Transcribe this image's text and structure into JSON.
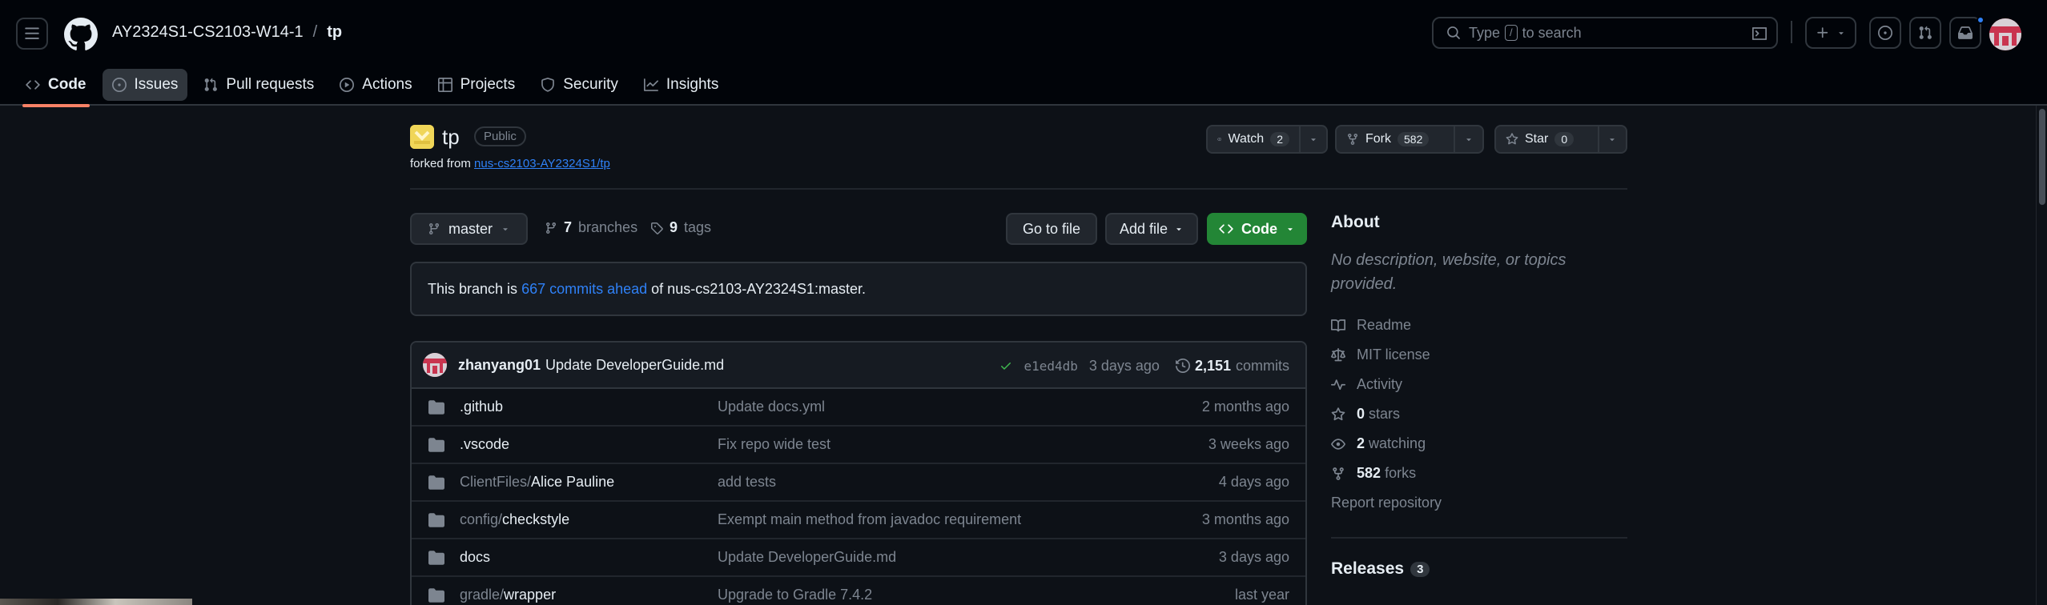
{
  "header": {
    "owner": "AY2324S1-CS2103-W14-1",
    "separator": "/",
    "repo": "tp",
    "search_placeholder_pre": "Type",
    "search_key": "/",
    "search_placeholder_post": "to search"
  },
  "tabs": [
    {
      "label": "Code"
    },
    {
      "label": "Issues"
    },
    {
      "label": "Pull requests"
    },
    {
      "label": "Actions"
    },
    {
      "label": "Projects"
    },
    {
      "label": "Security"
    },
    {
      "label": "Insights"
    }
  ],
  "repo": {
    "name": "tp",
    "visibility": "Public",
    "forked_from_label": "forked from",
    "forked_from": "nus-cs2103-AY2324S1/tp",
    "watch_label": "Watch",
    "watch_count": "2",
    "fork_label": "Fork",
    "fork_count": "582",
    "star_label": "Star",
    "star_count": "0"
  },
  "branch_bar": {
    "branch": "master",
    "branches_count": "7",
    "branches_label": "branches",
    "tags_count": "9",
    "tags_label": "tags",
    "go_to_file": "Go to file",
    "add_file": "Add file",
    "code": "Code"
  },
  "ahead": {
    "prefix": "This branch is",
    "link": "667 commits ahead",
    "suffix": "of nus-cs2103-AY2324S1:master."
  },
  "latest_commit": {
    "author": "zhanyang01",
    "message": "Update DeveloperGuide.md",
    "sha": "e1ed4db",
    "time": "3 days ago",
    "commits_count": "2,151",
    "commits_label": "commits"
  },
  "files": [
    {
      "dir": "",
      "name": ".github",
      "message": "Update docs.yml",
      "date": "2 months ago"
    },
    {
      "dir": "",
      "name": ".vscode",
      "message": "Fix repo wide test",
      "date": "3 weeks ago"
    },
    {
      "dir": "ClientFiles/",
      "name": "Alice Pauline",
      "message": "add tests",
      "date": "4 days ago"
    },
    {
      "dir": "config/",
      "name": "checkstyle",
      "message": "Exempt main method from javadoc requirement",
      "date": "3 months ago"
    },
    {
      "dir": "",
      "name": "docs",
      "message": "Update DeveloperGuide.md",
      "date": "3 days ago"
    },
    {
      "dir": "gradle/",
      "name": "wrapper",
      "message": "Upgrade to Gradle 7.4.2",
      "date": "last year"
    }
  ],
  "about": {
    "title": "About",
    "description": "No description, website, or topics provided.",
    "readme": "Readme",
    "license": "MIT license",
    "activity": "Activity",
    "stars_count": "0",
    "stars_label": "stars",
    "watching_count": "2",
    "watching_label": "watching",
    "forks_count": "582",
    "forks_label": "forks",
    "report": "Report repository",
    "releases_title": "Releases",
    "releases_count": "3"
  },
  "colors": {
    "background": "#0d1117",
    "accent_link": "#2f81f7",
    "code_button": "#238636",
    "active_tab_underline": "#f78166"
  }
}
